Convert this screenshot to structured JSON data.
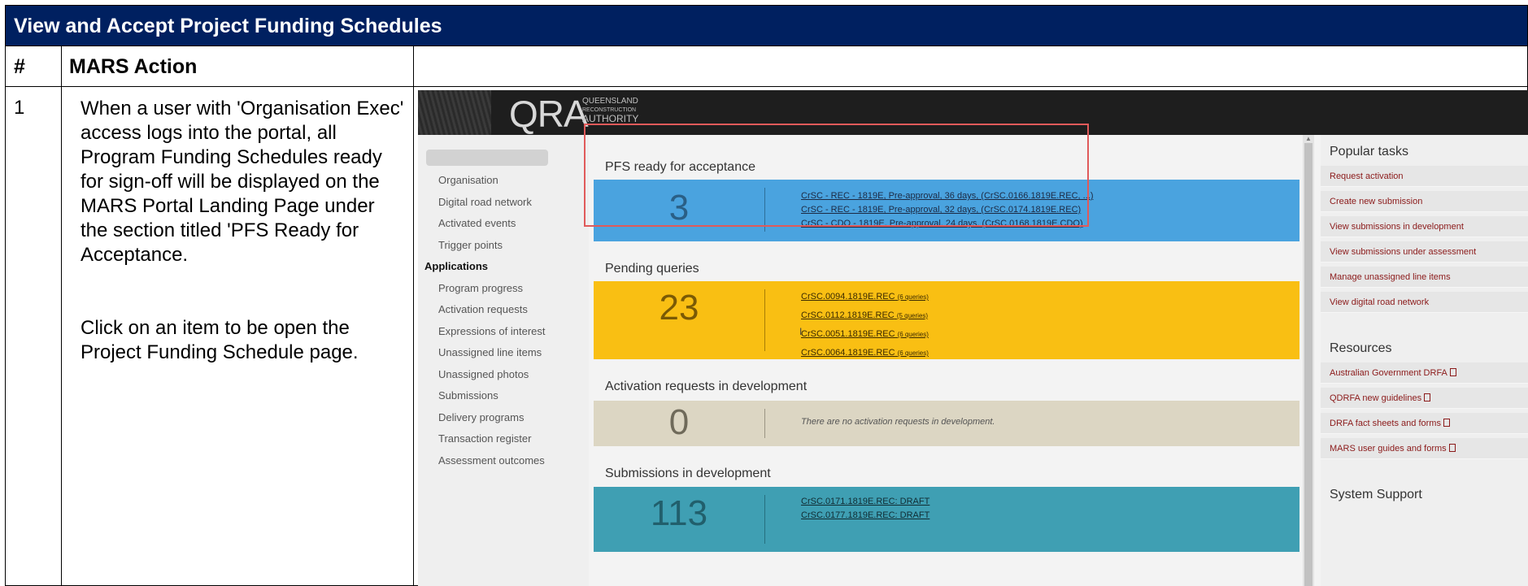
{
  "document": {
    "title": "View and Accept Project Funding Schedules",
    "col_num": "#",
    "col_action": "MARS Action",
    "row_number": "1",
    "action_para1": "When a user with 'Organisation Exec' access logs into the portal, all Program Funding Schedules ready for sign-off will be displayed on the MARS Portal Landing Page under the section titled 'PFS Ready for Acceptance.",
    "action_para2": "Click on an item to be open the Project Funding Schedule page."
  },
  "portal": {
    "logo": {
      "mark": "QRA",
      "line1": "QUEENSLAND",
      "line2": "RECONSTRUCTION",
      "line3": "AUTHORITY"
    },
    "nav": {
      "items": [
        "Organisation",
        "Digital road network",
        "Activated events",
        "Trigger points"
      ],
      "section": "Applications",
      "sub_items": [
        "Program progress",
        "Activation requests",
        "Expressions of interest",
        "Unassigned line items",
        "Unassigned photos",
        "Submissions",
        "Delivery programs",
        "Transaction register",
        "Assessment outcomes"
      ]
    },
    "pfs": {
      "title": "PFS ready for acceptance",
      "count": "3",
      "links": [
        "CrSC - REC - 1819E, Pre-approval, 36 days, (CrSC.0166.1819E.REC, ...)",
        "CrSC - REC - 1819E, Pre-approval, 32 days, (CrSC.0174.1819E.REC)",
        "CrSC - CDO - 1819E, Pre-approval, 24 days, (CrSC.0168.1819E.CDO)"
      ]
    },
    "queries": {
      "title": "Pending queries",
      "count": "23",
      "links": [
        {
          "code": "CrSC.0094.1819E.REC",
          "note": "(6 queries)"
        },
        {
          "code": "CrSC.0112.1819E.REC",
          "note": "(5 queries)"
        },
        {
          "code": "CrSC.0051.1819E.REC",
          "note": "(6 queries)"
        },
        {
          "code": "CrSC.0064.1819E.REC",
          "note": "(6 queries)"
        }
      ]
    },
    "activation": {
      "title": "Activation requests in development",
      "count": "0",
      "note": "There are no activation requests in development."
    },
    "submissions": {
      "title": "Submissions in development",
      "count": "113",
      "links": [
        "CrSC.0171.1819E.REC: DRAFT",
        "CrSC.0177.1819E.REC: DRAFT"
      ]
    },
    "popular": {
      "title": "Popular tasks",
      "items": [
        "Request activation",
        "Create new submission",
        "View submissions in development",
        "View submissions under assessment",
        "Manage unassigned line items",
        "View digital road network"
      ]
    },
    "resources": {
      "title": "Resources",
      "items": [
        "Australian Government DRFA",
        "QDRFA new guidelines",
        "DRFA fact sheets and forms",
        "MARS user guides and forms"
      ]
    },
    "support": {
      "title": "System Support"
    }
  },
  "colors": {
    "header_bg": "#002060",
    "pfs_panel": "#4aa3df",
    "queries_panel": "#f9bf13",
    "activation_panel": "#dcd6c3",
    "submissions_panel": "#3f9fb3",
    "highlight_border": "#e05a5a",
    "link_red": "#8b1a1a"
  }
}
